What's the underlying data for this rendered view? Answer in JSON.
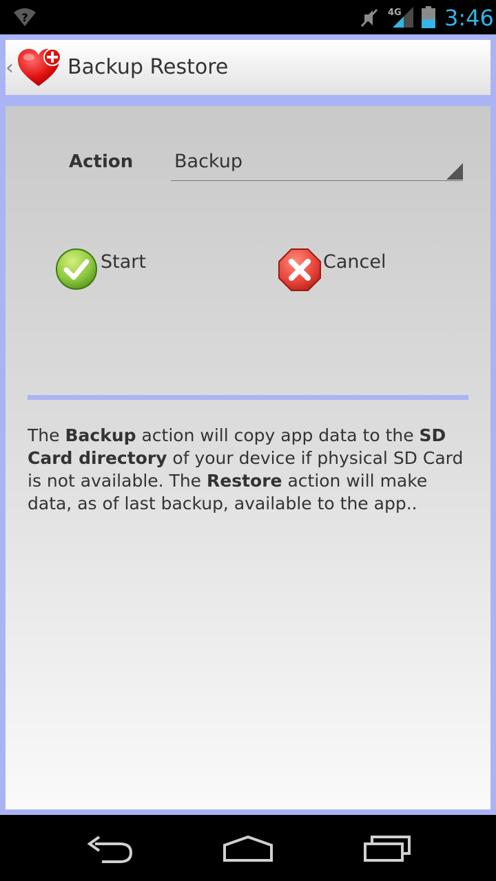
{
  "status_bar": {
    "time": "3:46",
    "network_type": "4G",
    "icons": [
      "wifi-unknown-icon",
      "mute-icon",
      "signal-icon",
      "battery-icon"
    ],
    "accent_color": "#33b5e5"
  },
  "action_bar": {
    "title": "Backup Restore",
    "icon": "heart-plus-icon"
  },
  "form": {
    "action_label": "Action",
    "action_selected": "Backup"
  },
  "buttons": {
    "start_label": "Start",
    "cancel_label": "Cancel"
  },
  "description": {
    "parts": [
      {
        "text": "The ",
        "bold": false
      },
      {
        "text": "Backup",
        "bold": true
      },
      {
        "text": " action will copy app data to the ",
        "bold": false
      },
      {
        "text": "SD Card directory",
        "bold": true
      },
      {
        "text": " of your device if physical SD Card is not available. The ",
        "bold": false
      },
      {
        "text": "Restore",
        "bold": true
      },
      {
        "text": " action will make data, as of last backup, available to the app..",
        "bold": false
      }
    ]
  },
  "nav_bar": {
    "icons": [
      "back-icon",
      "home-icon",
      "recent-apps-icon"
    ]
  },
  "colors": {
    "frame": "#aab4f5",
    "start_green": "#8cc63f",
    "cancel_red": "#e8463c",
    "heart_red": "#e01010"
  }
}
